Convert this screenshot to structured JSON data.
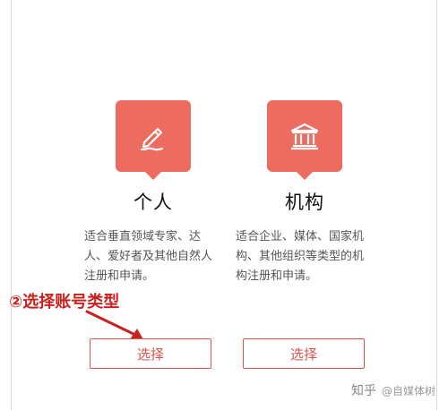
{
  "options": [
    {
      "icon": "pen-icon",
      "title": "个人",
      "description": "适合垂直领域专家、达人、爱好者及其他自然人注册和申请。",
      "button_label": "选择"
    },
    {
      "icon": "institution-building-icon",
      "title": "机构",
      "description": "适合企业、媒体、国家机构、其他组织等类型的机构注册和申请。",
      "button_label": "选择"
    }
  ],
  "annotation": {
    "text": "②选择账号类型",
    "color": "#c9211e"
  },
  "watermark": {
    "logo": "知乎",
    "text": "@自媒体树"
  },
  "colors": {
    "accent": "#ee6b5f",
    "button_border": "#d9534f"
  }
}
